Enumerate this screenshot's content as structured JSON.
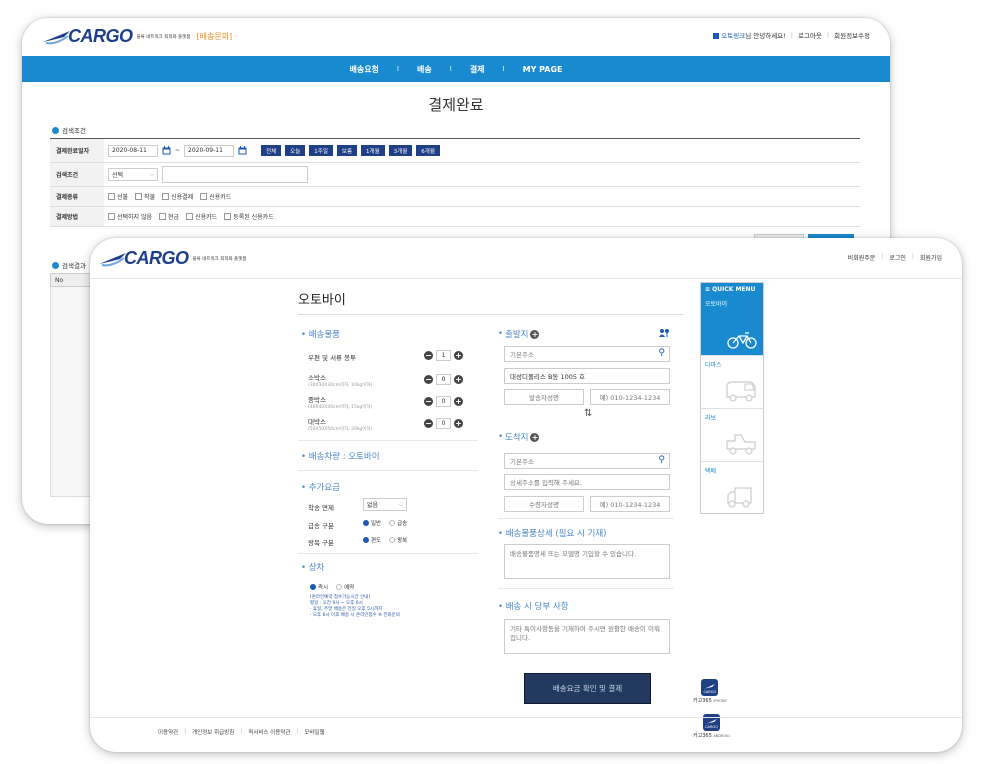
{
  "back_window": {
    "brand": "CARGO",
    "brand_sub": "물류 네트워크 최적화 플랫폼",
    "page_tag": "[배송문의] ·",
    "header_user": "오토링크",
    "header_greeting": "님 안녕하세요!",
    "header_links": [
      "로그아웃",
      "회원정보수정"
    ],
    "nav": [
      "배송요청",
      "배송",
      "결제",
      "MY PAGE"
    ],
    "title": "결제완료",
    "search_title": "검색조건",
    "filters": {
      "date_label": "결제완료일자",
      "date_from": "2020-08-11",
      "date_sep": "~",
      "date_to": "2020-09-11",
      "periods": [
        "전체",
        "오늘",
        "1주일",
        "보름",
        "1개월",
        "3개월",
        "6개월"
      ],
      "cond_label": "검색조건",
      "cond_select": "선택",
      "type_label": "결제종류",
      "types": [
        "선불",
        "착불",
        "신용결제",
        "신용카드"
      ],
      "method_label": "결제방법",
      "methods": [
        "선택하지 않음",
        "현금",
        "신용카드",
        "등록된 신용카드"
      ]
    },
    "result_title": "검색결과",
    "result_col": "No"
  },
  "front_window": {
    "brand": "CARGO",
    "brand_sub": "물류 네트워크 최적화 플랫폼",
    "header_links": [
      "비회원주문",
      "로그인",
      "회원가입"
    ],
    "title": "오토바이",
    "left": {
      "items_title": "배송물품",
      "items": [
        {
          "name": "우편 및 서류 봉투",
          "sub": "",
          "qty": "1"
        },
        {
          "name": "소박스",
          "sub": "(30X30X30cm이하, 10kg이하)",
          "qty": "0"
        },
        {
          "name": "중박스",
          "sub": "(40X40X40cm이하, 15kg이하)",
          "qty": "0"
        },
        {
          "name": "대박스",
          "sub": "(50X50X50cm이하, 20kg이하)",
          "qty": "0"
        }
      ],
      "vehicle": "배송차량 : 오토바이",
      "extra_title": "추가요금",
      "extra_rows": [
        {
          "label": "착송 면제",
          "select": "없음"
        },
        {
          "label": "급송 구분",
          "opts": [
            "일반",
            "급송"
          ]
        },
        {
          "label": "왕복 구분",
          "opts": [
            "편도",
            "왕복"
          ]
        }
      ],
      "pickup_title": "상차",
      "pickup_opts": [
        "즉시",
        "예약"
      ],
      "pickup_notes": [
        "[온라인예약 접수가능시간 안내]",
        "평일 : 오전 9시 ~ 오후 6시",
        "· 휴일, 주말 배송은 전일 오후 5시까지",
        "· 오후 6시 이후 배송 시 온라인접수 ※ 전화문의"
      ]
    },
    "right": {
      "origin_title": "출발지",
      "origin_addr_placeholder": "기본주소",
      "origin_detail": "대성디폴리스 B동 1005 호",
      "origin_name_placeholder": "발송자성명",
      "origin_phone_placeholder": "예) 010-1234-1234",
      "swap_icon": "⇅",
      "dest_title": "도착지",
      "dest_addr_placeholder": "기본주소",
      "dest_detail_placeholder": "상세주소를 입력해 주세요.",
      "dest_name_placeholder": "수령자성명",
      "dest_phone_placeholder": "예) 010-1234-1234",
      "detail_title": "배송물품상세 (필요 시 기재)",
      "detail_placeholder": "배송물품명세 또는 모델명 기입할 수 있습니다.",
      "note_title": "배송 시 당부 사항",
      "note_placeholder": "기타 특이사항등을 기재하여 주시면 원활한 배송이 이뤄집니다."
    },
    "pay_button": "배송요금 확인 및 결제",
    "quick_menu": {
      "title": "≡ QUICK MENU",
      "items": [
        "오토바이",
        "다마스",
        "라보",
        "택배"
      ]
    },
    "apps": [
      {
        "name": "카고365",
        "os": "IPHONE",
        "icon_label": "CARGO"
      },
      {
        "name": "카고365",
        "os": "ANDROID",
        "icon_label": "CARGO"
      }
    ],
    "footer": [
      "이용약관",
      "개인정보 취급방침",
      "퀵서비스 이용약관",
      "모바일웹"
    ]
  }
}
